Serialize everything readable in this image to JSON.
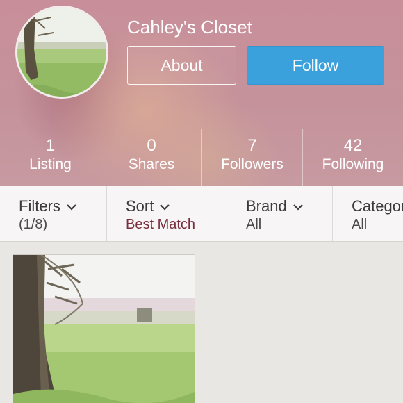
{
  "profile": {
    "closet_name": "Cahley's Closet",
    "avatar_alt": "closet avatar photo",
    "about_label": "About",
    "follow_label": "Follow",
    "follow_color": "#3aa1dc"
  },
  "stats": [
    {
      "count": "1",
      "label": "Listing"
    },
    {
      "count": "0",
      "label": "Shares"
    },
    {
      "count": "7",
      "label": "Followers"
    },
    {
      "count": "42",
      "label": "Following"
    }
  ],
  "filters": [
    {
      "label": "Filters",
      "value": "(1/8)"
    },
    {
      "label": "Sort",
      "value": "Best Match"
    },
    {
      "label": "Brand",
      "value": "All"
    },
    {
      "label": "Category",
      "value": "All"
    }
  ],
  "colors": {
    "sort_value": "#7a2e3d",
    "header_tint": "#c88f9a"
  },
  "icons": {
    "dropdown": "chevron-down-icon"
  },
  "listings": [
    {
      "image": "field-with-tree-photo"
    }
  ]
}
